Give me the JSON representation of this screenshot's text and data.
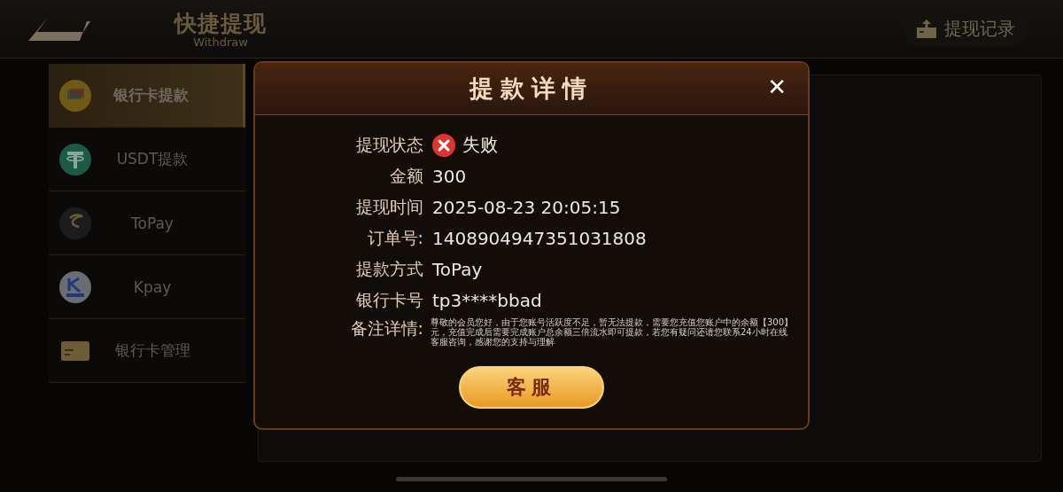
{
  "header": {
    "title": "快捷提现",
    "subtitle": "Withdraw",
    "records_button": "提现记录"
  },
  "sidebar": {
    "items": [
      {
        "label": "银行卡提款",
        "kind": "card",
        "selected": true
      },
      {
        "label": "USDT提款",
        "kind": "usdt",
        "selected": false
      },
      {
        "label": "ToPay",
        "kind": "topay",
        "selected": false
      },
      {
        "label": "Kpay",
        "kind": "kpay",
        "selected": false
      },
      {
        "label": "银行卡管理",
        "kind": "manage",
        "selected": false
      }
    ]
  },
  "dialog": {
    "title": "提款详情",
    "close": "✕",
    "fields": [
      {
        "kind": "status",
        "label": "提现状态",
        "value": "失败"
      },
      {
        "kind": "text",
        "label": "金额",
        "value": "300"
      },
      {
        "kind": "text",
        "label": "提现时间",
        "value": "2025-08-23 20:05:15"
      },
      {
        "kind": "text",
        "label": "订单号:",
        "value": "1408904947351031808"
      },
      {
        "kind": "text",
        "label": "提款方式",
        "value": "ToPay"
      },
      {
        "kind": "text",
        "label": "银行卡号",
        "value": "tp3****bbad"
      }
    ],
    "note_label": "备注详情:",
    "note": "尊敬的会员您好，由于您账号活跃度不足，暂无法提款，需要您充值您账户中的余额【300】元，充值完成后需要完成账户总余额三倍流水即可提款，若您有疑问还请您联系24小时在线客服咨询，感谢您的支持与理解",
    "button": "客服"
  }
}
